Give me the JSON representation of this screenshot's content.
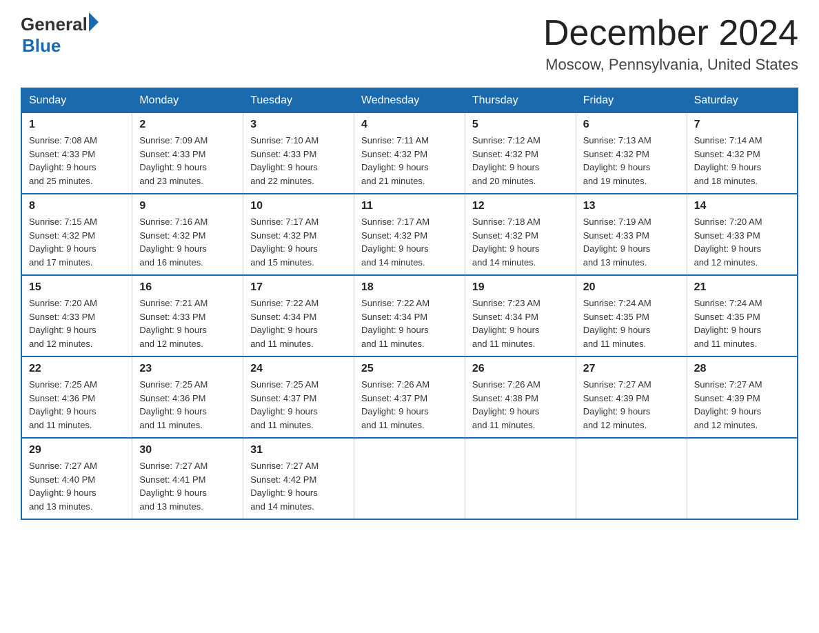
{
  "header": {
    "logo_general": "General",
    "logo_blue": "Blue",
    "title": "December 2024",
    "location": "Moscow, Pennsylvania, United States"
  },
  "days_of_week": [
    "Sunday",
    "Monday",
    "Tuesday",
    "Wednesday",
    "Thursday",
    "Friday",
    "Saturday"
  ],
  "weeks": [
    [
      {
        "day": "1",
        "sunrise": "7:08 AM",
        "sunset": "4:33 PM",
        "daylight": "9 hours and 25 minutes."
      },
      {
        "day": "2",
        "sunrise": "7:09 AM",
        "sunset": "4:33 PM",
        "daylight": "9 hours and 23 minutes."
      },
      {
        "day": "3",
        "sunrise": "7:10 AM",
        "sunset": "4:33 PM",
        "daylight": "9 hours and 22 minutes."
      },
      {
        "day": "4",
        "sunrise": "7:11 AM",
        "sunset": "4:32 PM",
        "daylight": "9 hours and 21 minutes."
      },
      {
        "day": "5",
        "sunrise": "7:12 AM",
        "sunset": "4:32 PM",
        "daylight": "9 hours and 20 minutes."
      },
      {
        "day": "6",
        "sunrise": "7:13 AM",
        "sunset": "4:32 PM",
        "daylight": "9 hours and 19 minutes."
      },
      {
        "day": "7",
        "sunrise": "7:14 AM",
        "sunset": "4:32 PM",
        "daylight": "9 hours and 18 minutes."
      }
    ],
    [
      {
        "day": "8",
        "sunrise": "7:15 AM",
        "sunset": "4:32 PM",
        "daylight": "9 hours and 17 minutes."
      },
      {
        "day": "9",
        "sunrise": "7:16 AM",
        "sunset": "4:32 PM",
        "daylight": "9 hours and 16 minutes."
      },
      {
        "day": "10",
        "sunrise": "7:17 AM",
        "sunset": "4:32 PM",
        "daylight": "9 hours and 15 minutes."
      },
      {
        "day": "11",
        "sunrise": "7:17 AM",
        "sunset": "4:32 PM",
        "daylight": "9 hours and 14 minutes."
      },
      {
        "day": "12",
        "sunrise": "7:18 AM",
        "sunset": "4:32 PM",
        "daylight": "9 hours and 14 minutes."
      },
      {
        "day": "13",
        "sunrise": "7:19 AM",
        "sunset": "4:33 PM",
        "daylight": "9 hours and 13 minutes."
      },
      {
        "day": "14",
        "sunrise": "7:20 AM",
        "sunset": "4:33 PM",
        "daylight": "9 hours and 12 minutes."
      }
    ],
    [
      {
        "day": "15",
        "sunrise": "7:20 AM",
        "sunset": "4:33 PM",
        "daylight": "9 hours and 12 minutes."
      },
      {
        "day": "16",
        "sunrise": "7:21 AM",
        "sunset": "4:33 PM",
        "daylight": "9 hours and 12 minutes."
      },
      {
        "day": "17",
        "sunrise": "7:22 AM",
        "sunset": "4:34 PM",
        "daylight": "9 hours and 11 minutes."
      },
      {
        "day": "18",
        "sunrise": "7:22 AM",
        "sunset": "4:34 PM",
        "daylight": "9 hours and 11 minutes."
      },
      {
        "day": "19",
        "sunrise": "7:23 AM",
        "sunset": "4:34 PM",
        "daylight": "9 hours and 11 minutes."
      },
      {
        "day": "20",
        "sunrise": "7:24 AM",
        "sunset": "4:35 PM",
        "daylight": "9 hours and 11 minutes."
      },
      {
        "day": "21",
        "sunrise": "7:24 AM",
        "sunset": "4:35 PM",
        "daylight": "9 hours and 11 minutes."
      }
    ],
    [
      {
        "day": "22",
        "sunrise": "7:25 AM",
        "sunset": "4:36 PM",
        "daylight": "9 hours and 11 minutes."
      },
      {
        "day": "23",
        "sunrise": "7:25 AM",
        "sunset": "4:36 PM",
        "daylight": "9 hours and 11 minutes."
      },
      {
        "day": "24",
        "sunrise": "7:25 AM",
        "sunset": "4:37 PM",
        "daylight": "9 hours and 11 minutes."
      },
      {
        "day": "25",
        "sunrise": "7:26 AM",
        "sunset": "4:37 PM",
        "daylight": "9 hours and 11 minutes."
      },
      {
        "day": "26",
        "sunrise": "7:26 AM",
        "sunset": "4:38 PM",
        "daylight": "9 hours and 11 minutes."
      },
      {
        "day": "27",
        "sunrise": "7:27 AM",
        "sunset": "4:39 PM",
        "daylight": "9 hours and 12 minutes."
      },
      {
        "day": "28",
        "sunrise": "7:27 AM",
        "sunset": "4:39 PM",
        "daylight": "9 hours and 12 minutes."
      }
    ],
    [
      {
        "day": "29",
        "sunrise": "7:27 AM",
        "sunset": "4:40 PM",
        "daylight": "9 hours and 13 minutes."
      },
      {
        "day": "30",
        "sunrise": "7:27 AM",
        "sunset": "4:41 PM",
        "daylight": "9 hours and 13 minutes."
      },
      {
        "day": "31",
        "sunrise": "7:27 AM",
        "sunset": "4:42 PM",
        "daylight": "9 hours and 14 minutes."
      },
      null,
      null,
      null,
      null
    ]
  ],
  "labels": {
    "sunrise": "Sunrise:",
    "sunset": "Sunset:",
    "daylight": "Daylight:"
  }
}
